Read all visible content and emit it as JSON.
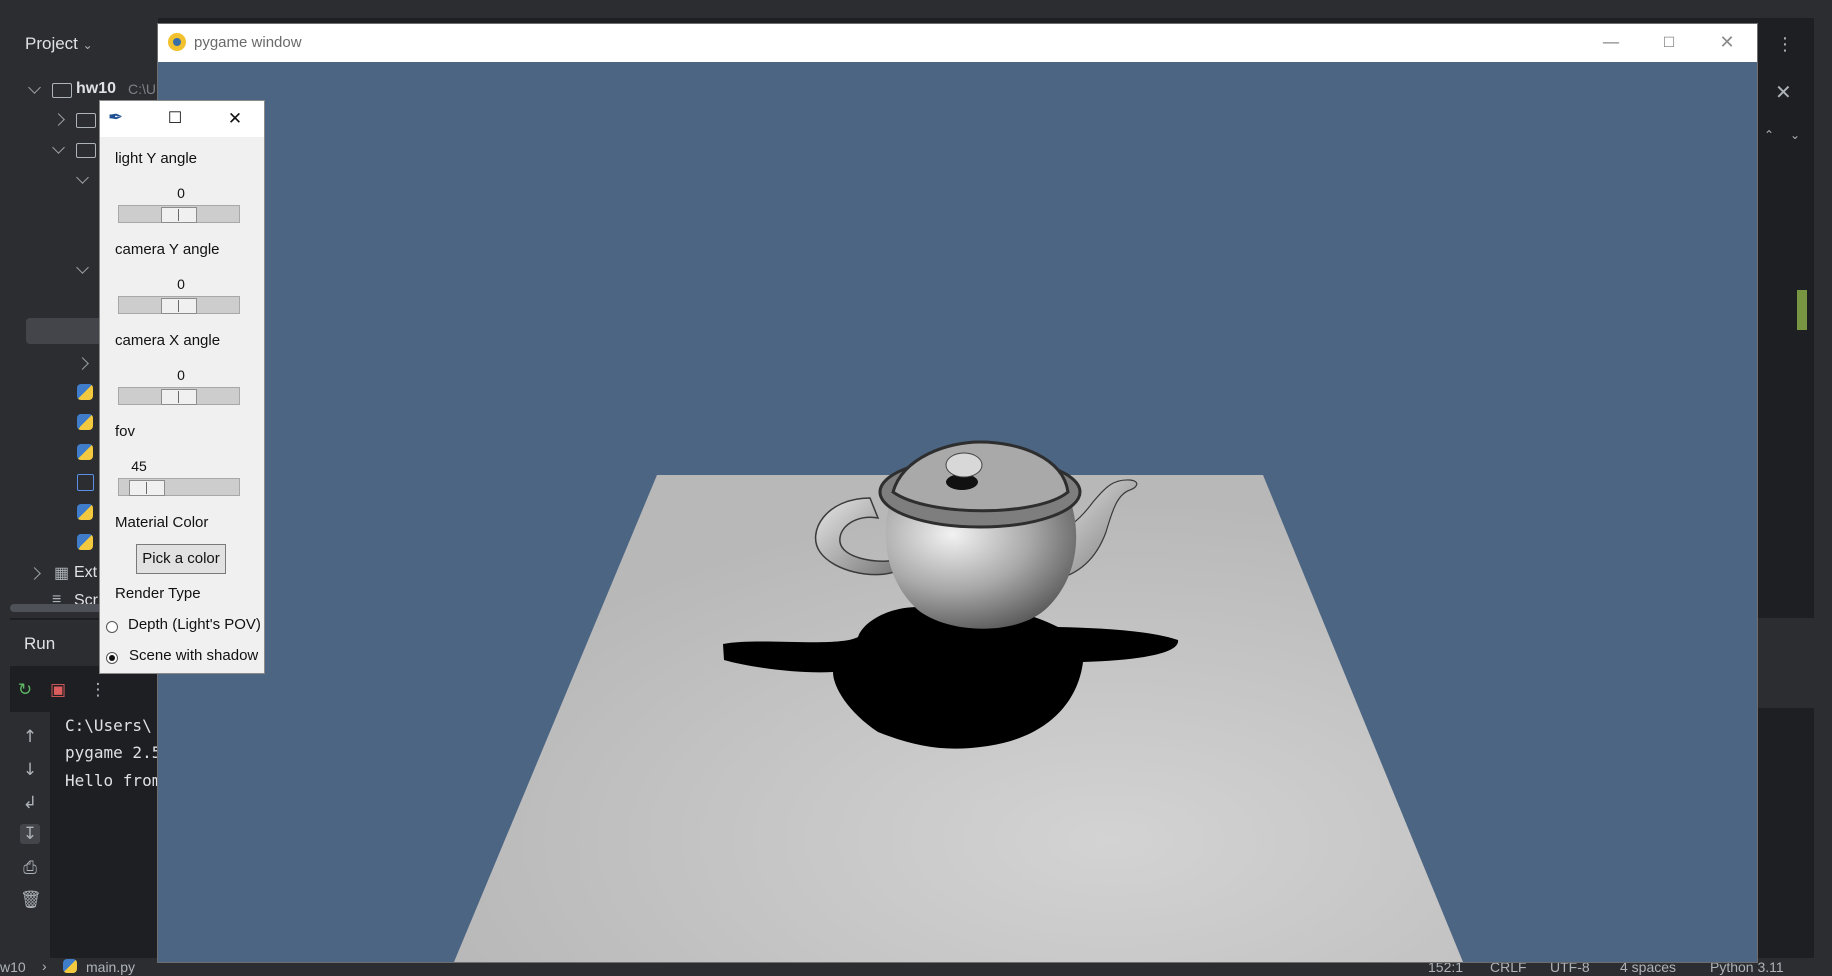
{
  "ide": {
    "project_title": "Project",
    "root_folder": "hw10",
    "root_path": "C:\\U",
    "external_libs": "Ext",
    "scratches": "Scr",
    "run_title": "Run",
    "console_lines": [
      "C:\\Users\\",
      "pygame 2.5",
      "Hello from"
    ],
    "status": {
      "breadcrumb_project": "w10",
      "breadcrumb_file": "main.py",
      "position": "152:1",
      "line_ending": "CRLF",
      "encoding": "UTF-8",
      "indent": "4 spaces",
      "interpreter": "Python 3.11"
    }
  },
  "pygame_window": {
    "title": "pygame window",
    "minimize_icon": "minimize-icon",
    "maximize_icon": "maximize-icon",
    "close_icon": "close-icon",
    "background_color": "#4c6582",
    "plane_color": "#c3c3c3",
    "shadow_color": "#000000"
  },
  "controls": {
    "window_icon": "feather-icon",
    "light_y": {
      "label": "light Y angle",
      "value": "0",
      "fraction": 0.5
    },
    "camera_y": {
      "label": "camera Y angle",
      "value": "0",
      "fraction": 0.5
    },
    "camera_x": {
      "label": "camera X angle",
      "value": "0",
      "fraction": 0.5
    },
    "fov": {
      "label": "fov",
      "value": "45",
      "fraction": 0.12
    },
    "material": {
      "label": "Material Color",
      "button": "Pick a color"
    },
    "render": {
      "label": "Render Type",
      "options": [
        {
          "label": "Depth (Light's POV)",
          "selected": false
        },
        {
          "label": "Scene with shadow",
          "selected": true
        }
      ]
    }
  }
}
